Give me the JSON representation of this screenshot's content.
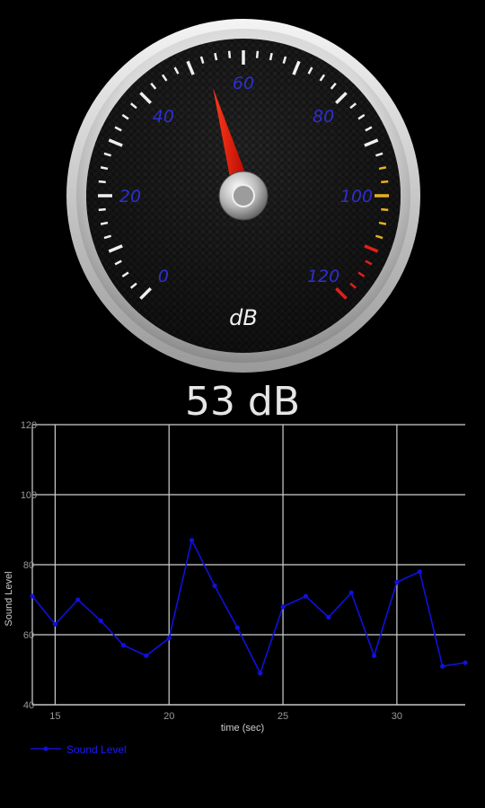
{
  "gauge": {
    "unit_label": "dB",
    "scale_labels": [
      "0",
      "20",
      "40",
      "60",
      "80",
      "100",
      "120"
    ],
    "min": 0,
    "max": 120,
    "needle_value": 53,
    "label_color": "#2f2fd0",
    "warning_color": "#e8b020",
    "danger_color": "#e0201a"
  },
  "reading": {
    "value_text": "53 dB"
  },
  "chart_data": {
    "type": "line",
    "xlabel": "time (sec)",
    "ylabel": "Sound Level",
    "xlim": [
      14,
      33
    ],
    "ylim": [
      40,
      120
    ],
    "xticks": [
      "15",
      "20",
      "25",
      "30"
    ],
    "yticks": [
      "40",
      "60",
      "80",
      "100",
      "120"
    ],
    "grid": true,
    "legend_position": "bottom-left",
    "series": [
      {
        "name": "Sound Level",
        "color": "#1010e0",
        "x": [
          14,
          15,
          16,
          17,
          18,
          19,
          20,
          21,
          22,
          23,
          24,
          25,
          26,
          27,
          28,
          29,
          30,
          31,
          32,
          33
        ],
        "y": [
          71,
          63,
          70,
          64,
          57,
          54,
          59,
          87,
          74,
          62,
          49,
          68,
          71,
          65,
          72,
          54,
          75,
          78,
          51,
          52
        ]
      }
    ]
  }
}
